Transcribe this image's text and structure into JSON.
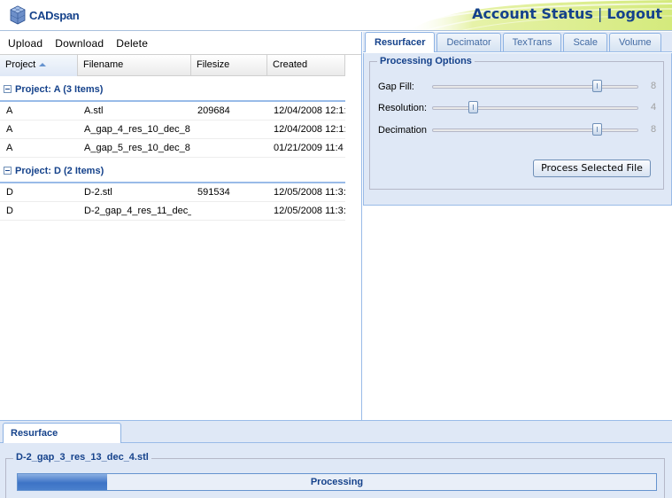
{
  "header": {
    "logo_text": "CADspan",
    "account_status": "Account Status",
    "separator": "|",
    "logout": "Logout",
    "accent_color": "#15428b"
  },
  "toolbar": {
    "upload": "Upload",
    "download": "Download",
    "delete": "Delete"
  },
  "grid": {
    "columns": [
      "Project",
      "Filename",
      "Filesize",
      "Created"
    ],
    "sort_column": "Project",
    "sort_direction": "asc",
    "groups": [
      {
        "title": "Project: A (3 Items)",
        "rows": [
          [
            "A",
            "A.stl",
            "209684",
            "12/04/2008 12:1:"
          ],
          [
            "A",
            "A_gap_4_res_10_dec_8",
            "",
            "12/04/2008 12:1:"
          ],
          [
            "A",
            "A_gap_5_res_10_dec_8",
            "",
            "01/21/2009 11:4"
          ]
        ]
      },
      {
        "title": "Project: D (2 Items)",
        "rows": [
          [
            "D",
            "D-2.stl",
            "591534",
            "12/05/2008 11:3:"
          ],
          [
            "D",
            "D-2_gap_4_res_11_dec_",
            "",
            "12/05/2008 11:3:"
          ]
        ]
      }
    ]
  },
  "tools": {
    "tabs": [
      "Resurfacer",
      "Decimator",
      "TexTrans",
      "Scale",
      "Volume"
    ],
    "active_tab": "Resurfacer",
    "fieldset_title": "Processing Options",
    "sliders": [
      {
        "label": "Gap Fill:",
        "value": "8",
        "fraction": 0.8
      },
      {
        "label": "Resolution:",
        "value": "4",
        "fraction": 0.2
      },
      {
        "label": "Decimation",
        "value": "8",
        "fraction": 0.8
      }
    ],
    "process_button": "Process Selected File"
  },
  "bottom": {
    "tab": "Resurface",
    "file": "D-2_gap_3_res_13_dec_4.stl",
    "progress_text": "Processing",
    "progress_fraction": 0.14
  }
}
